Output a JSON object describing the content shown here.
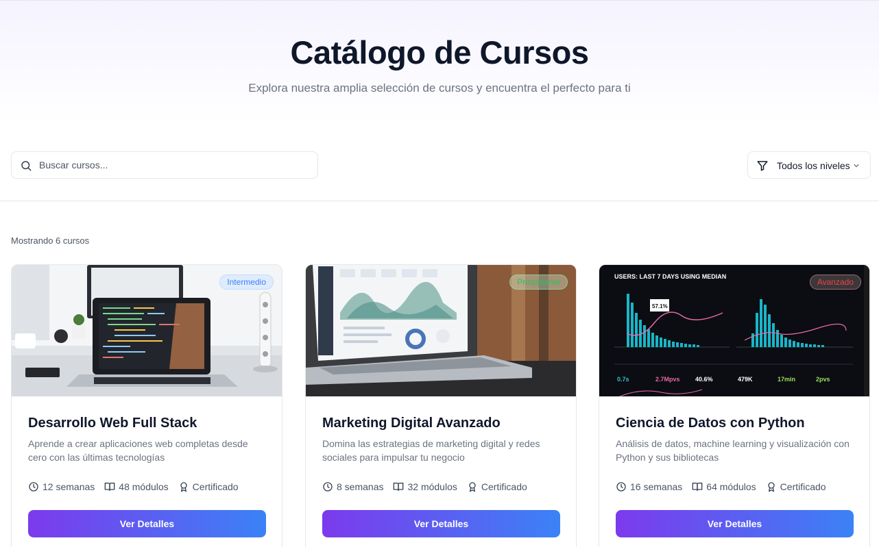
{
  "hero": {
    "title": "Catálogo de Cursos",
    "subtitle": "Explora nuestra amplia selección de cursos y encuentra el perfecto para ti"
  },
  "search": {
    "placeholder": "Buscar cursos...",
    "value": ""
  },
  "level_filter": {
    "selected": "Todos los niveles"
  },
  "results": {
    "count_text": "Mostrando 6 cursos"
  },
  "courses": [
    {
      "level": "Intermedio",
      "title": "Desarrollo Web Full Stack",
      "description": "Aprende a crear aplicaciones web completas desde cero con las últimas tecnologías",
      "duration": "12 semanas",
      "modules": "48 módulos",
      "certificate": "Certificado",
      "cta": "Ver Detalles"
    },
    {
      "level": "Principiante",
      "title": "Marketing Digital Avanzado",
      "description": "Domina las estrategias de marketing digital y redes sociales para impulsar tu negocio",
      "duration": "8 semanas",
      "modules": "32 módulos",
      "certificate": "Certificado",
      "cta": "Ver Detalles"
    },
    {
      "level": "Avanzado",
      "title": "Ciencia de Datos con Python",
      "description": "Análisis de datos, machine learning y visualización con Python y sus bibliotecas",
      "duration": "16 semanas",
      "modules": "64 módulos",
      "certificate": "Certificado",
      "cta": "Ver Detalles"
    }
  ],
  "thumb3": {
    "header": "USERS: LAST 7 DAYS USING MEDIAN",
    "kpis": [
      "0.7s",
      "2.7Mpvs",
      "40.6%",
      "479K",
      "17min",
      "2pvs"
    ],
    "callout": "57.1%"
  },
  "colors": {
    "accent_start": "#7c3aed",
    "accent_end": "#3b82f6",
    "intermedio": "#3b82f6",
    "principiante": "#22c55e",
    "avanzado": "#ef4444"
  },
  "icons": [
    "search-icon",
    "filter-icon",
    "chevron-down-icon",
    "clock-icon",
    "book-icon",
    "award-icon"
  ]
}
